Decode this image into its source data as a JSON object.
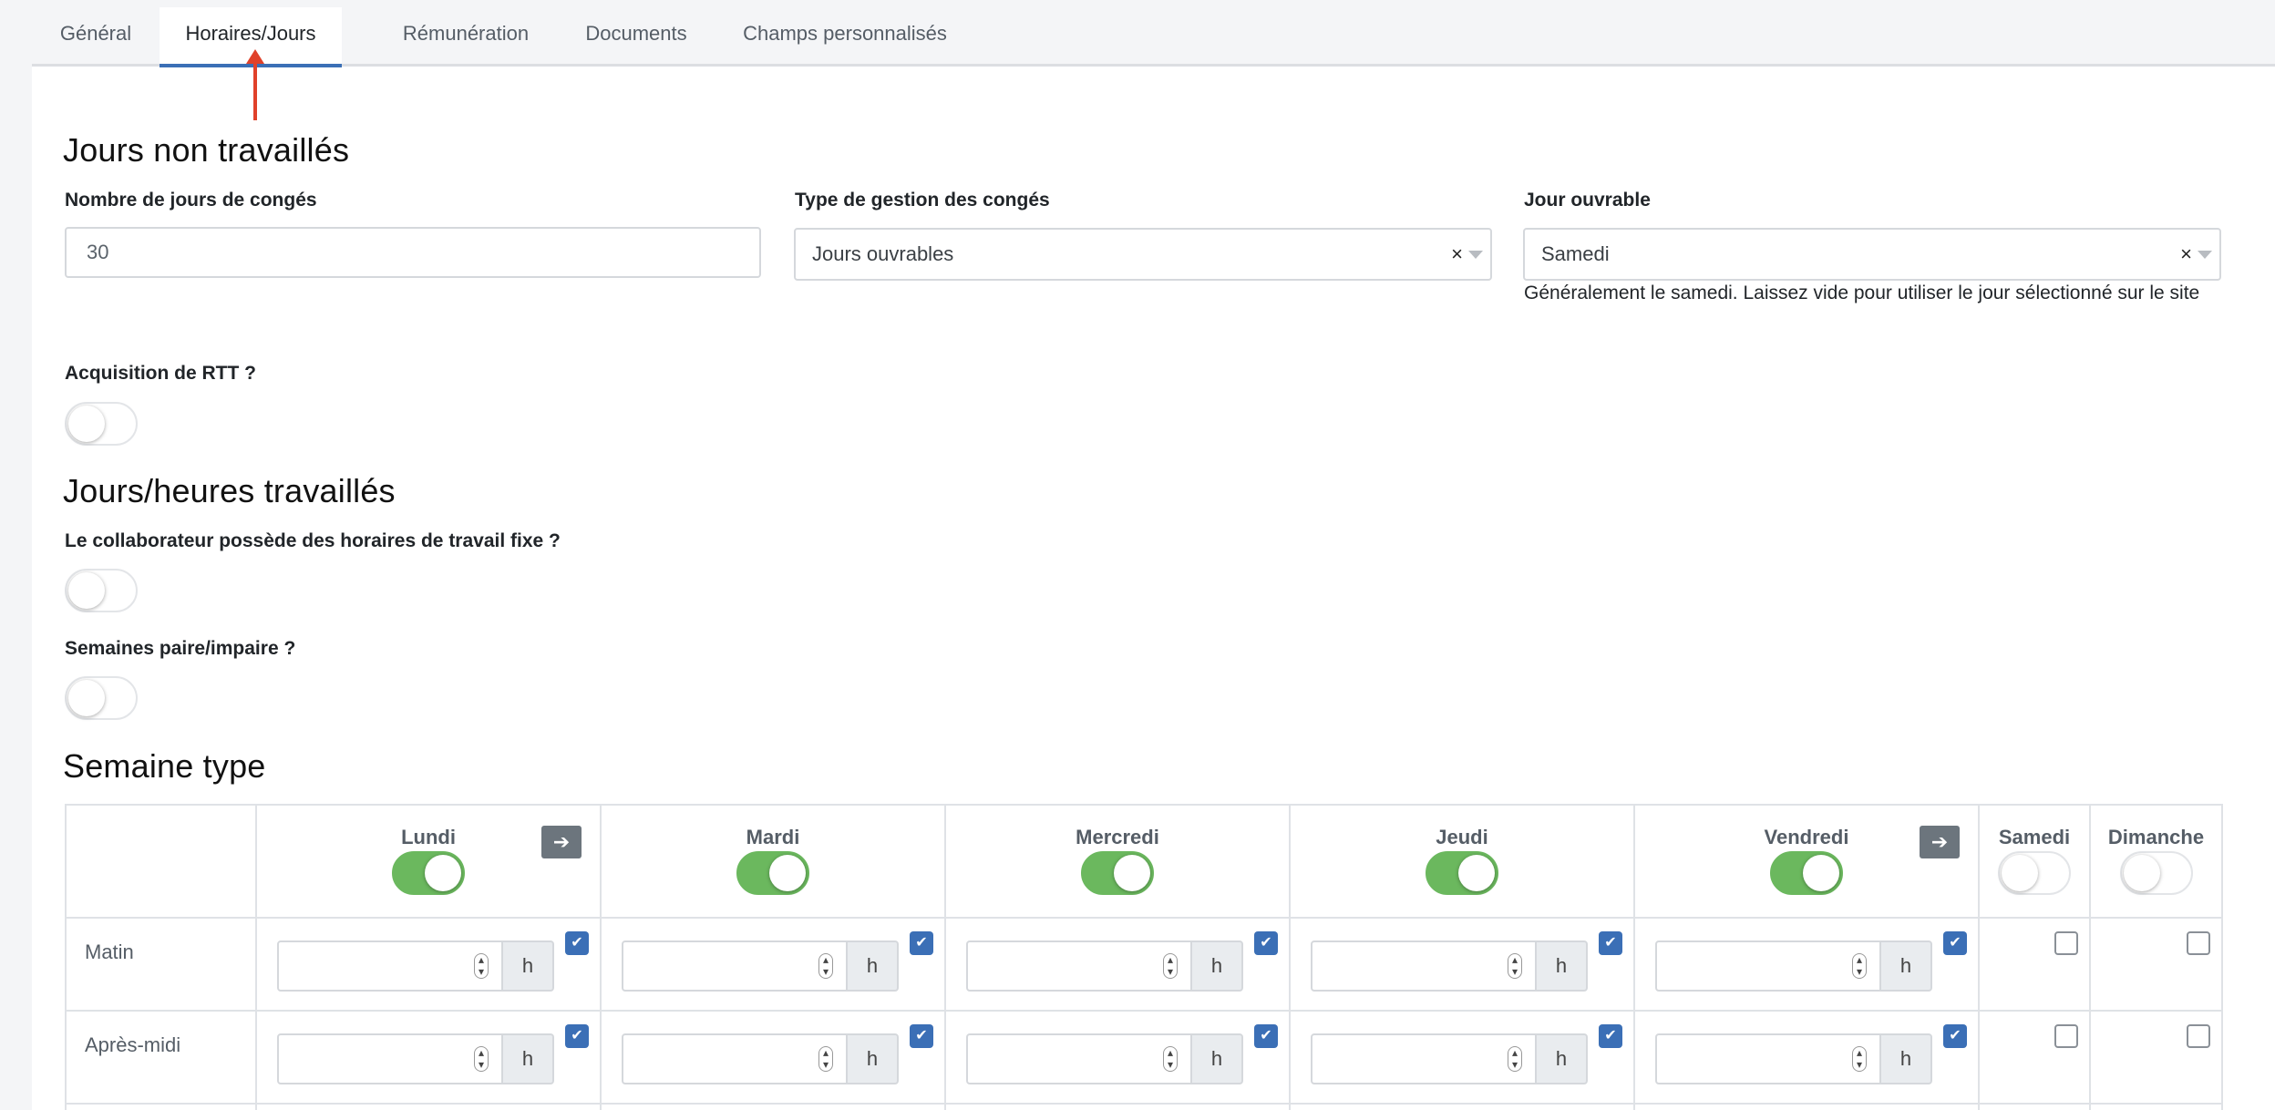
{
  "tabs": [
    {
      "label": "Général"
    },
    {
      "label": "Horaires/Jours"
    },
    {
      "label": "Rémunération"
    },
    {
      "label": "Documents"
    },
    {
      "label": "Champs personnalisés"
    }
  ],
  "active_tab": "Horaires/Jours",
  "section_non_worked": {
    "title": "Jours non travaillés",
    "leave_days": {
      "label": "Nombre de jours de congés",
      "value": "30"
    },
    "leave_type": {
      "label": "Type de gestion des congés",
      "value": "Jours ouvrables",
      "clear": "×"
    },
    "working_day": {
      "label": "Jour ouvrable",
      "value": "Samedi",
      "clear": "×",
      "help": "Généralement le samedi. Laissez vide pour utiliser le jour sélectionné sur le site"
    },
    "rtt": {
      "label": "Acquisition de RTT ?",
      "on": false
    }
  },
  "section_worked": {
    "title": "Jours/heures travaillés",
    "fixed_hours": {
      "label": "Le collaborateur possède des horaires de travail fixe ?",
      "on": false
    },
    "even_odd": {
      "label": "Semaines paire/impaire ?",
      "on": false
    }
  },
  "week": {
    "title": "Semaine type",
    "unit": "h",
    "copy_glyph": "➔",
    "days": [
      {
        "name": "Lundi",
        "on": true,
        "copy": true,
        "hours": true
      },
      {
        "name": "Mardi",
        "on": true,
        "copy": false,
        "hours": true
      },
      {
        "name": "Mercredi",
        "on": true,
        "copy": false,
        "hours": true
      },
      {
        "name": "Jeudi",
        "on": true,
        "copy": false,
        "hours": true
      },
      {
        "name": "Vendredi",
        "on": true,
        "copy": true,
        "hours": true
      },
      {
        "name": "Samedi",
        "on": false,
        "copy": false,
        "hours": false
      },
      {
        "name": "Dimanche",
        "on": false,
        "copy": false,
        "hours": false
      }
    ],
    "rows": [
      {
        "label": "Matin"
      },
      {
        "label": "Après-midi"
      }
    ]
  },
  "colors": {
    "accent": "#3b6fb6",
    "toggle_on": "#6bb85e",
    "annotation_arrow": "#e0412a"
  }
}
